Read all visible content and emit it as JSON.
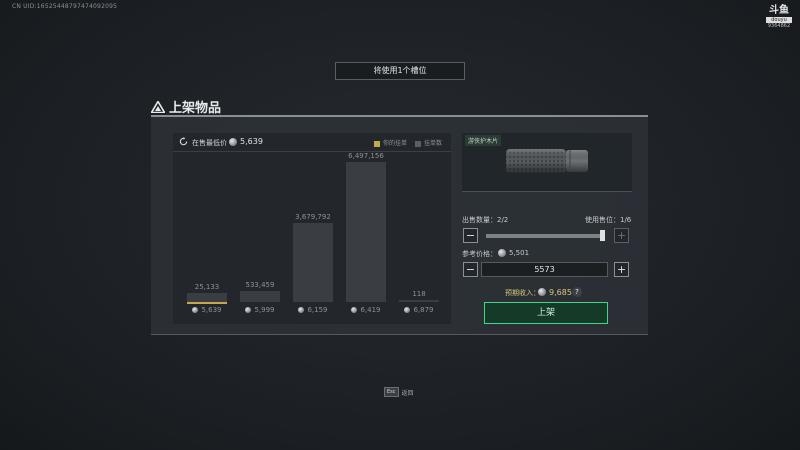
{
  "hud": {
    "uid": "CN UID:16525448797474092095",
    "logo_main": "斗鱼",
    "logo_sub": "douyu",
    "logo_id": "9364862"
  },
  "slot_banner": "将使用1个槽位",
  "title": "上架物品",
  "chart": {
    "lowest_label": "在售最低价",
    "lowest_price": "5,639",
    "legend_mine": "你的挂单",
    "legend_orders": "挂单数",
    "ticks": [
      {
        "count": "25,133",
        "price": "5,639"
      },
      {
        "count": "533,459",
        "price": "5,999"
      },
      {
        "count": "3,679,792",
        "price": "6,159"
      },
      {
        "count": "6,497,156",
        "price": "6,419"
      },
      {
        "count": "118",
        "price": "6,879"
      }
    ]
  },
  "chart_data": {
    "type": "bar",
    "categories": [
      "5,639",
      "5,999",
      "6,159",
      "6,419",
      "6,879"
    ],
    "series": [
      {
        "name": "挂单数",
        "values": [
          25133,
          533459,
          3679792,
          6497156,
          118
        ]
      }
    ],
    "mine_index": 0,
    "title": "",
    "xlabel": "",
    "ylabel": ""
  },
  "item": {
    "name": "游侠护木片"
  },
  "quantity": {
    "label": "出售数量：",
    "value": "2/2",
    "fraction": 1.0,
    "slot_label": "使用售位：",
    "slot_value": "1/6",
    "minus": "−",
    "plus": "+"
  },
  "price": {
    "ref_label": "参考价格：",
    "ref_value": "5,501",
    "input_value": "5573",
    "minus": "−",
    "plus": "+"
  },
  "income": {
    "label": "预期收入：",
    "value": "9,685",
    "help": "?"
  },
  "list_button": "上架",
  "footer": {
    "esc_key": "Esc",
    "esc_label": "返回"
  },
  "colors": {
    "accent_green": "#3fd58a",
    "mine_gold": "#c4a850",
    "income_gold": "#d9c57e"
  }
}
